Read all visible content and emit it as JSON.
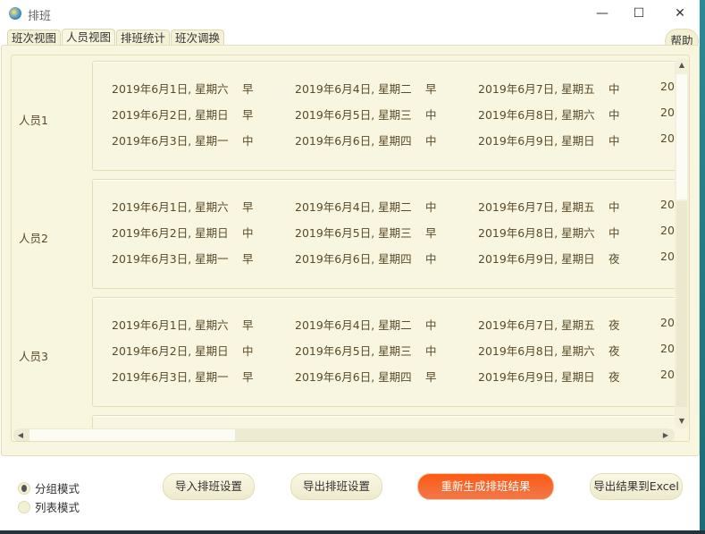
{
  "window": {
    "title": "排班",
    "minimize": "—",
    "maximize": "☐",
    "close": "✕"
  },
  "tabs": [
    "班次视图",
    "人员视图",
    "排班统计",
    "班次调换"
  ],
  "active_tab": 1,
  "help_label": "帮助",
  "groups": [
    {
      "name": "人员1",
      "columns": [
        [
          [
            "2019年6月1日, 星期六",
            "早"
          ],
          [
            "2019年6月2日, 星期日",
            "早"
          ],
          [
            "2019年6月3日, 星期一",
            "中"
          ]
        ],
        [
          [
            "2019年6月4日, 星期二",
            "早"
          ],
          [
            "2019年6月5日, 星期三",
            "中"
          ],
          [
            "2019年6月6日, 星期四",
            "中"
          ]
        ],
        [
          [
            "2019年6月7日, 星期五",
            "中"
          ],
          [
            "2019年6月8日, 星期六",
            "中"
          ],
          [
            "2019年6月9日, 星期日",
            "中"
          ]
        ]
      ],
      "overflow": "20"
    },
    {
      "name": "人员2",
      "columns": [
        [
          [
            "2019年6月1日, 星期六",
            "早"
          ],
          [
            "2019年6月2日, 星期日",
            "中"
          ],
          [
            "2019年6月3日, 星期一",
            "早"
          ]
        ],
        [
          [
            "2019年6月4日, 星期二",
            "中"
          ],
          [
            "2019年6月5日, 星期三",
            "早"
          ],
          [
            "2019年6月6日, 星期四",
            "中"
          ]
        ],
        [
          [
            "2019年6月7日, 星期五",
            "中"
          ],
          [
            "2019年6月8日, 星期六",
            "中"
          ],
          [
            "2019年6月9日, 星期日",
            "夜"
          ]
        ]
      ],
      "overflow": "20"
    },
    {
      "name": "人员3",
      "columns": [
        [
          [
            "2019年6月1日, 星期六",
            "早"
          ],
          [
            "2019年6月2日, 星期日",
            "中"
          ],
          [
            "2019年6月3日, 星期一",
            "早"
          ]
        ],
        [
          [
            "2019年6月4日, 星期二",
            "中"
          ],
          [
            "2019年6月5日, 星期三",
            "中"
          ],
          [
            "2019年6月6日, 星期四",
            "早"
          ]
        ],
        [
          [
            "2019年6月7日, 星期五",
            "夜"
          ],
          [
            "2019年6月8日, 星期六",
            "夜"
          ],
          [
            "2019年6月9日, 星期日",
            "夜"
          ]
        ]
      ],
      "overflow": "20"
    }
  ],
  "modes": {
    "group": "分组模式",
    "list": "列表模式",
    "selected": "group"
  },
  "buttons": {
    "import": "导入排班设置",
    "export": "导出排班设置",
    "regenerate": "重新生成排班结果",
    "export_excel": "导出结果到Excel"
  },
  "colors": {
    "accent": "#ff5a14",
    "panel": "#f8f6df",
    "text": "#5a4a2a"
  }
}
